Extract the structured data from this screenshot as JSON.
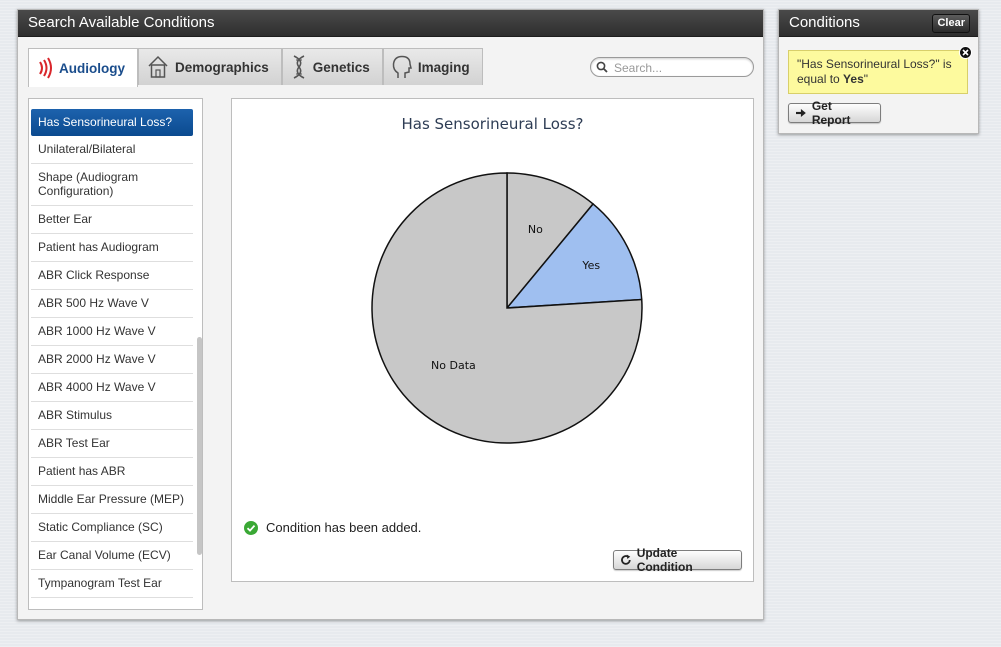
{
  "search_panel": {
    "title": "Search Available Conditions",
    "tabs": [
      {
        "label": "Audiology",
        "icon": "audiology-icon",
        "active": true
      },
      {
        "label": "Demographics",
        "icon": "house-icon",
        "active": false
      },
      {
        "label": "Genetics",
        "icon": "dna-icon",
        "active": false
      },
      {
        "label": "Imaging",
        "icon": "head-icon",
        "active": false
      }
    ],
    "search_placeholder": "Search...",
    "conditions_list": [
      "Has Sensorineural Loss?",
      "Unilateral/Bilateral",
      "Shape (Audiogram Configuration)",
      "Better Ear",
      "Patient has Audiogram",
      "ABR Click Response",
      "ABR 500 Hz Wave V",
      "ABR 1000 Hz Wave V",
      "ABR 2000 Hz Wave V",
      "ABR 4000 Hz Wave V",
      "ABR Stimulus",
      "ABR Test Ear",
      "Patient has ABR",
      "Middle Ear Pressure (MEP)",
      "Static Compliance (SC)",
      "Ear Canal Volume (ECV)",
      "Tympanogram Test Ear"
    ],
    "selected_index": 0,
    "status_message": "Condition has been added.",
    "update_button": "Update Condition"
  },
  "chart_data": {
    "type": "pie",
    "title": "Has Sensorineural Loss?",
    "slices": [
      {
        "label": "No",
        "value": 11,
        "color": "#c8c8c8"
      },
      {
        "label": "Yes",
        "value": 13,
        "color": "#9fbff0"
      },
      {
        "label": "No Data",
        "value": 76,
        "color": "#c8c8c8"
      }
    ]
  },
  "conditions_panel": {
    "title": "Conditions",
    "clear_label": "Clear",
    "condition_prefix": "\"Has Sensorineural Loss?\" is equal to ",
    "condition_value": "Yes",
    "condition_suffix": "\"",
    "report_button": "Get Report"
  },
  "colors": {
    "accent": "#1a4d8c",
    "selected_bg": "#0b4a8f",
    "header_bg": "#333333",
    "note_bg": "#fdfa9e",
    "success": "#3aa835"
  }
}
